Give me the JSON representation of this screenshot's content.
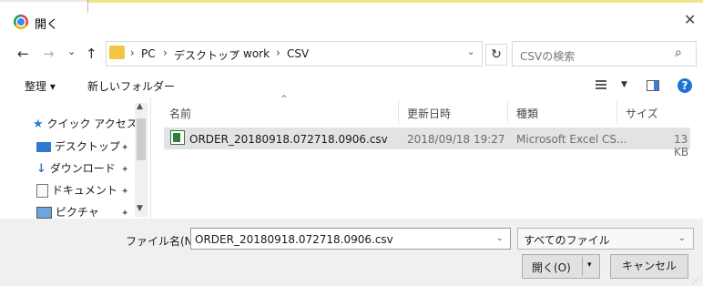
{
  "window": {
    "title": "開く",
    "close_glyph": "✕"
  },
  "nav": {
    "back": "←",
    "forward": "→",
    "recent": "⌄",
    "up": "↑",
    "breadcrumb": [
      "PC",
      "デスクトップ",
      "work",
      "CSV"
    ],
    "separator": "›",
    "addr_dropdown": "⌄",
    "refresh": "↻",
    "search_placeholder": "CSVの検索",
    "search_glyph": "⌕"
  },
  "toolbar": {
    "organize_label": "整理 ▾",
    "new_folder_label": "新しいフォルダー",
    "view_dropdown": "▼",
    "help_glyph": "?"
  },
  "sidebar": {
    "items": [
      {
        "label": "クイック アクセス",
        "icon": "star-icon"
      },
      {
        "label": "デスクトップ",
        "icon": "desktop-icon"
      },
      {
        "label": "ダウンロード",
        "icon": "download-icon"
      },
      {
        "label": "ドキュメント",
        "icon": "document-icon"
      },
      {
        "label": "ピクチャ",
        "icon": "pictures-icon"
      }
    ],
    "pin_glyph": "✦",
    "scroll_up": "▲",
    "scroll_down": "▼"
  },
  "files": {
    "sort_caret": "^",
    "columns": [
      "名前",
      "更新日時",
      "種類",
      "サイズ"
    ],
    "rows": [
      {
        "name": "ORDER_20180918.072718.0906.csv",
        "modified": "2018/09/18 19:27",
        "type": "Microsoft Excel CS...",
        "size": "13 KB"
      }
    ]
  },
  "footer": {
    "filename_label": "ファイル名(N):",
    "filename_value": "ORDER_20180918.072718.0906.csv",
    "filetype_value": "すべてのファイル",
    "dropdown_glyph": "⌄",
    "open_label": "開く(O)",
    "open_split": "▾",
    "cancel_label": "キャンセル",
    "grip": "⋰"
  },
  "colors": {
    "selection": "#e3e3e3",
    "accent": "#1e73d6",
    "folder": "#f4c542",
    "excel": "#2f7d3b"
  }
}
